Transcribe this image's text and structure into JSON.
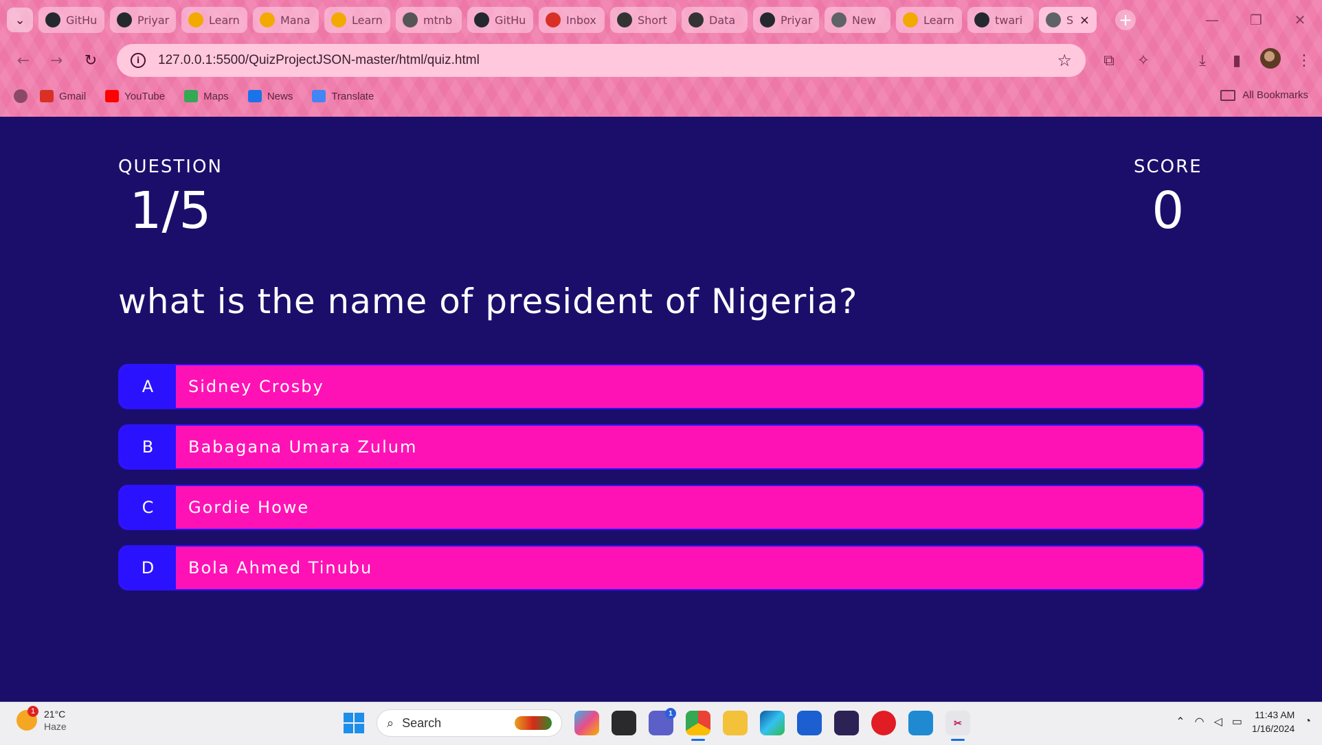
{
  "browser": {
    "tabs": [
      {
        "label": "GitHu",
        "icon": "github-icon",
        "color": "#24292f"
      },
      {
        "label": "Priyar",
        "icon": "github-icon",
        "color": "#24292f"
      },
      {
        "label": "Learn",
        "icon": "analytics-icon",
        "color": "#f2a900"
      },
      {
        "label": "Mana",
        "icon": "analytics-icon",
        "color": "#f2a900"
      },
      {
        "label": "Learn",
        "icon": "analytics-icon",
        "color": "#f2a900"
      },
      {
        "label": "mtnb",
        "icon": "mtn-icon",
        "color": "#555555"
      },
      {
        "label": "GitHu",
        "icon": "github-icon",
        "color": "#24292f"
      },
      {
        "label": "Inbox",
        "icon": "gmail-icon",
        "color": "#d93025"
      },
      {
        "label": "Short",
        "icon": "hot-icon",
        "color": "#333333"
      },
      {
        "label": "Data",
        "icon": "hot-icon",
        "color": "#333333"
      },
      {
        "label": "Priyar",
        "icon": "github-icon",
        "color": "#24292f"
      },
      {
        "label": "New",
        "icon": "chrome-icon",
        "color": "#5f6368"
      },
      {
        "label": "Learn",
        "icon": "analytics-icon",
        "color": "#f2a900"
      },
      {
        "label": "twari",
        "icon": "github-icon",
        "color": "#24292f"
      }
    ],
    "active_tab": {
      "label": "S",
      "icon": "globe-icon",
      "color": "#5f6368"
    },
    "url": "127.0.0.1:5500/QuizProjectJSON-master/html/quiz.html",
    "bookmarks": [
      {
        "label": "Gmail",
        "icon": "gmail-icon",
        "color": "#d93025"
      },
      {
        "label": "YouTube",
        "icon": "youtube-icon",
        "color": "#ff0000"
      },
      {
        "label": "Maps",
        "icon": "maps-icon",
        "color": "#34a853"
      },
      {
        "label": "News",
        "icon": "news-icon",
        "color": "#1a73e8"
      },
      {
        "label": "Translate",
        "icon": "translate-icon",
        "color": "#4285f4"
      }
    ],
    "all_bookmarks_label": "All Bookmarks"
  },
  "quiz": {
    "question_label": "QUESTION",
    "question_counter": "1/5",
    "score_label": "SCORE",
    "score_value": "0",
    "question_text": "what is the name of president of Nigeria?",
    "options": [
      {
        "prefix": "A",
        "text": "Sidney Crosby"
      },
      {
        "prefix": "B",
        "text": "Babagana Umara Zulum"
      },
      {
        "prefix": "C",
        "text": "Gordie Howe"
      },
      {
        "prefix": "D",
        "text": "Bola Ahmed Tinubu"
      }
    ],
    "colors": {
      "background": "#1b0e6b",
      "option_bg": "#ff12b5",
      "prefix_bg": "#2b12ff"
    }
  },
  "taskbar": {
    "weather_temp": "21°C",
    "weather_condition": "Haze",
    "weather_badge": "1",
    "search_placeholder": "Search",
    "teams_badge": "1",
    "time": "11:43 AM",
    "date": "1/16/2024"
  }
}
